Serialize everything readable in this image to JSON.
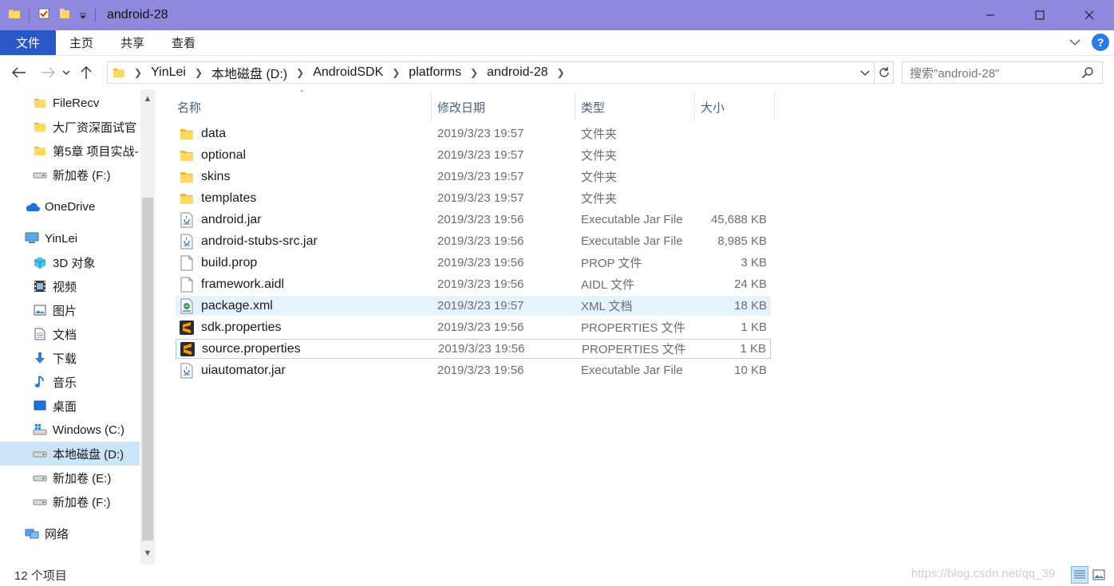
{
  "window": {
    "title": "android-28",
    "accent_color": "#8f88dc"
  },
  "ribbon": {
    "tabs": [
      {
        "label": "文件",
        "active": true
      },
      {
        "label": "主页",
        "active": false
      },
      {
        "label": "共享",
        "active": false
      },
      {
        "label": "查看",
        "active": false
      }
    ],
    "help_label": "?"
  },
  "address": {
    "breadcrumbs": [
      "YinLei",
      "本地磁盘 (D:)",
      "AndroidSDK",
      "platforms",
      "android-28"
    ]
  },
  "search": {
    "placeholder": "搜索\"android-28\""
  },
  "sidebar": {
    "items": [
      {
        "label": "FileRecv",
        "icon": "folder-icon"
      },
      {
        "label": "大厂资深面试官",
        "icon": "folder-icon"
      },
      {
        "label": "第5章 项目实战-",
        "icon": "folder-icon"
      },
      {
        "label": "新加卷 (F:)",
        "icon": "drive-icon"
      },
      {
        "label": "OneDrive",
        "icon": "cloud-icon"
      },
      {
        "label": "YinLei",
        "icon": "computer-icon"
      },
      {
        "label": "3D 对象",
        "icon": "cube-icon"
      },
      {
        "label": "视频",
        "icon": "video-icon"
      },
      {
        "label": "图片",
        "icon": "picture-icon"
      },
      {
        "label": "文档",
        "icon": "document-icon"
      },
      {
        "label": "下载",
        "icon": "download-icon"
      },
      {
        "label": "音乐",
        "icon": "music-icon"
      },
      {
        "label": "桌面",
        "icon": "desktop-icon"
      },
      {
        "label": "Windows (C:)",
        "icon": "windows-drive-icon"
      },
      {
        "label": "本地磁盘 (D:)",
        "icon": "drive-icon",
        "selected": true
      },
      {
        "label": "新加卷 (E:)",
        "icon": "drive-icon"
      },
      {
        "label": "新加卷 (F:)",
        "icon": "drive-icon"
      },
      {
        "label": "网络",
        "icon": "network-icon"
      }
    ]
  },
  "columns": {
    "name": "名称",
    "date": "修改日期",
    "type": "类型",
    "size": "大小"
  },
  "files": [
    {
      "name": "data",
      "date": "2019/3/23 19:57",
      "type": "文件夹",
      "size": "",
      "icon": "folder-icon"
    },
    {
      "name": "optional",
      "date": "2019/3/23 19:57",
      "type": "文件夹",
      "size": "",
      "icon": "folder-icon"
    },
    {
      "name": "skins",
      "date": "2019/3/23 19:57",
      "type": "文件夹",
      "size": "",
      "icon": "folder-icon"
    },
    {
      "name": "templates",
      "date": "2019/3/23 19:57",
      "type": "文件夹",
      "size": "",
      "icon": "folder-icon"
    },
    {
      "name": "android.jar",
      "date": "2019/3/23 19:56",
      "type": "Executable Jar File",
      "size": "45,688 KB",
      "icon": "jar-icon"
    },
    {
      "name": "android-stubs-src.jar",
      "date": "2019/3/23 19:56",
      "type": "Executable Jar File",
      "size": "8,985 KB",
      "icon": "jar-icon"
    },
    {
      "name": "build.prop",
      "date": "2019/3/23 19:56",
      "type": "PROP 文件",
      "size": "3 KB",
      "icon": "file-icon"
    },
    {
      "name": "framework.aidl",
      "date": "2019/3/23 19:56",
      "type": "AIDL 文件",
      "size": "24 KB",
      "icon": "file-icon"
    },
    {
      "name": "package.xml",
      "date": "2019/3/23 19:57",
      "type": "XML 文档",
      "size": "18 KB",
      "icon": "xml-icon",
      "hover": true
    },
    {
      "name": "sdk.properties",
      "date": "2019/3/23 19:56",
      "type": "PROPERTIES 文件",
      "size": "1 KB",
      "icon": "sublime-icon"
    },
    {
      "name": "source.properties",
      "date": "2019/3/23 19:56",
      "type": "PROPERTIES 文件",
      "size": "1 KB",
      "icon": "sublime-icon",
      "focus": true
    },
    {
      "name": "uiautomator.jar",
      "date": "2019/3/23 19:56",
      "type": "Executable Jar File",
      "size": "10 KB",
      "icon": "jar-icon"
    }
  ],
  "status": {
    "count": "12 个项目",
    "watermark": "https://blog.csdn.net/qq_39"
  }
}
